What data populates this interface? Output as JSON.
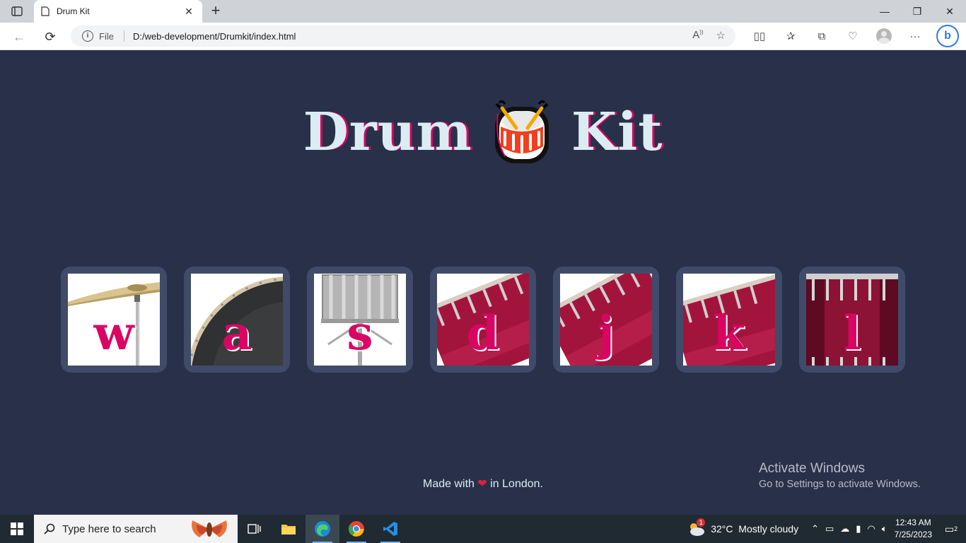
{
  "browser": {
    "tab_title": "Drum Kit",
    "address_scheme": "File",
    "address_url": "D:/web-development/Drumkit/index.html"
  },
  "page": {
    "title_left": "Drum",
    "title_right": "Kit",
    "title_icon": "drum-emoji-icon",
    "drums": [
      {
        "key": "w",
        "instrument": "crash-cymbal"
      },
      {
        "key": "a",
        "instrument": "kick-bass"
      },
      {
        "key": "s",
        "instrument": "snare"
      },
      {
        "key": "d",
        "instrument": "tom-1"
      },
      {
        "key": "j",
        "instrument": "tom-2"
      },
      {
        "key": "k",
        "instrument": "tom-3"
      },
      {
        "key": "l",
        "instrument": "tom-4"
      }
    ],
    "footer_before": "Made with",
    "footer_after": "in London."
  },
  "watermark": {
    "title": "Activate Windows",
    "subtitle": "Go to Settings to activate Windows."
  },
  "taskbar": {
    "search_placeholder": "Type here to search",
    "weather_temp": "32°C",
    "weather_desc": "Mostly cloudy",
    "weather_badge": "1",
    "time": "12:43 AM",
    "date": "7/25/2023",
    "notification_count": "2"
  },
  "colors": {
    "background": "#283149",
    "button_frame": "#404b69",
    "accent": "#da0463",
    "title_text": "#dbedf3"
  }
}
